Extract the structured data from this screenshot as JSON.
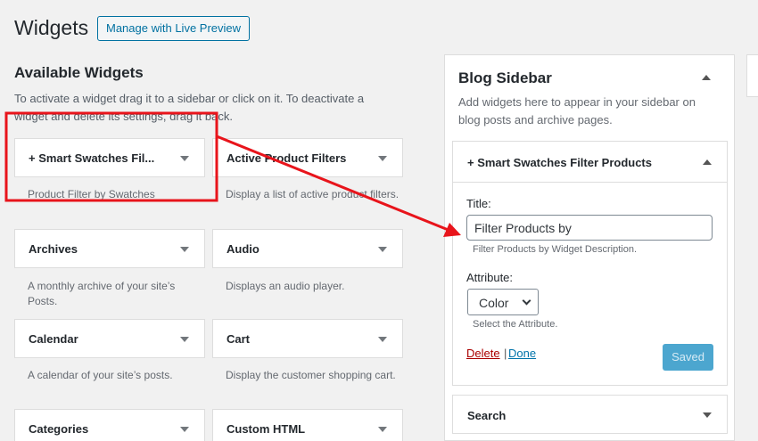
{
  "header": {
    "title": "Widgets",
    "live_preview_label": "Manage with Live Preview"
  },
  "available": {
    "title": "Available Widgets",
    "description": "To activate a widget drag it to a sidebar or click on it. To deactivate a widget and delete its settings, drag it back.",
    "widgets": [
      {
        "name": "+ Smart Swatches Fil...",
        "desc": "Product Filter by Swatches"
      },
      {
        "name": "Active Product Filters",
        "desc": "Display a list of active product filters."
      },
      {
        "name": "Archives",
        "desc": "A monthly archive of your site’s Posts."
      },
      {
        "name": "Audio",
        "desc": "Displays an audio player."
      },
      {
        "name": "Calendar",
        "desc": "A calendar of your site’s posts."
      },
      {
        "name": "Cart",
        "desc": "Display the customer shopping cart."
      },
      {
        "name": "Categories",
        "desc": ""
      },
      {
        "name": "Custom HTML",
        "desc": ""
      }
    ]
  },
  "sidebar": {
    "title": "Blog Sidebar",
    "description": "Add widgets here to appear in your sidebar on blog posts and archive pages.",
    "open_widget": {
      "name": "+ Smart Swatches Filter Products",
      "title_label": "Title:",
      "title_value": "Filter Products by",
      "title_hint": "Filter Products by Widget Description.",
      "attribute_label": "Attribute:",
      "attribute_value": "Color",
      "attribute_hint": "Select the Attribute.",
      "delete_label": "Delete",
      "separator": "|",
      "done_label": "Done",
      "saved_label": "Saved"
    },
    "second_widget": "Search"
  },
  "colors": {
    "annotation": "#e8141b",
    "link": "#0073aa",
    "delete": "#aa0000",
    "saved_button": "#4ca6cf"
  }
}
